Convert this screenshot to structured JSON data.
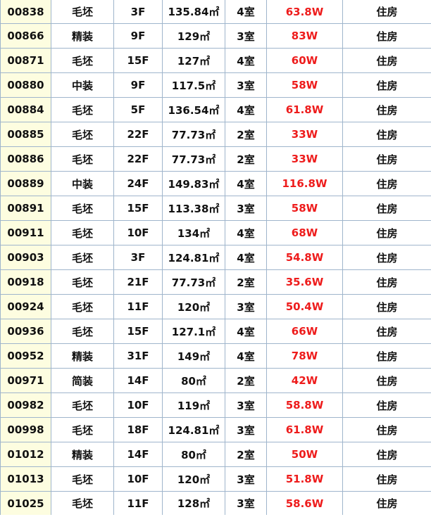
{
  "rows": [
    {
      "id": "00838",
      "decoration": "毛坯",
      "floor": "3F",
      "area": "135.84㎡",
      "rooms": "4室",
      "price": "63.8W",
      "type": "住房"
    },
    {
      "id": "00866",
      "decoration": "精装",
      "floor": "9F",
      "area": "129㎡",
      "rooms": "3室",
      "price": "83W",
      "type": "住房"
    },
    {
      "id": "00871",
      "decoration": "毛坯",
      "floor": "15F",
      "area": "127㎡",
      "rooms": "4室",
      "price": "60W",
      "type": "住房"
    },
    {
      "id": "00880",
      "decoration": "中装",
      "floor": "9F",
      "area": "117.5㎡",
      "rooms": "3室",
      "price": "58W",
      "type": "住房"
    },
    {
      "id": "00884",
      "decoration": "毛坯",
      "floor": "5F",
      "area": "136.54㎡",
      "rooms": "4室",
      "price": "61.8W",
      "type": "住房"
    },
    {
      "id": "00885",
      "decoration": "毛坯",
      "floor": "22F",
      "area": "77.73㎡",
      "rooms": "2室",
      "price": "33W",
      "type": "住房"
    },
    {
      "id": "00886",
      "decoration": "毛坯",
      "floor": "22F",
      "area": "77.73㎡",
      "rooms": "2室",
      "price": "33W",
      "type": "住房"
    },
    {
      "id": "00889",
      "decoration": "中装",
      "floor": "24F",
      "area": "149.83㎡",
      "rooms": "4室",
      "price": "116.8W",
      "type": "住房"
    },
    {
      "id": "00891",
      "decoration": "毛坯",
      "floor": "15F",
      "area": "113.38㎡",
      "rooms": "3室",
      "price": "58W",
      "type": "住房"
    },
    {
      "id": "00911",
      "decoration": "毛坯",
      "floor": "10F",
      "area": "134㎡",
      "rooms": "4室",
      "price": "68W",
      "type": "住房"
    },
    {
      "id": "00903",
      "decoration": "毛坯",
      "floor": "3F",
      "area": "124.81㎡",
      "rooms": "4室",
      "price": "54.8W",
      "type": "住房"
    },
    {
      "id": "00918",
      "decoration": "毛坯",
      "floor": "21F",
      "area": "77.73㎡",
      "rooms": "2室",
      "price": "35.6W",
      "type": "住房"
    },
    {
      "id": "00924",
      "decoration": "毛坯",
      "floor": "11F",
      "area": "120㎡",
      "rooms": "3室",
      "price": "50.4W",
      "type": "住房"
    },
    {
      "id": "00936",
      "decoration": "毛坯",
      "floor": "15F",
      "area": "127.1㎡",
      "rooms": "4室",
      "price": "66W",
      "type": "住房"
    },
    {
      "id": "00952",
      "decoration": "精装",
      "floor": "31F",
      "area": "149㎡",
      "rooms": "4室",
      "price": "78W",
      "type": "住房"
    },
    {
      "id": "00971",
      "decoration": "简装",
      "floor": "14F",
      "area": "80㎡",
      "rooms": "2室",
      "price": "42W",
      "type": "住房"
    },
    {
      "id": "00982",
      "decoration": "毛坯",
      "floor": "10F",
      "area": "119㎡",
      "rooms": "3室",
      "price": "58.8W",
      "type": "住房"
    },
    {
      "id": "00998",
      "decoration": "毛坯",
      "floor": "18F",
      "area": "124.81㎡",
      "rooms": "3室",
      "price": "61.8W",
      "type": "住房"
    },
    {
      "id": "01012",
      "decoration": "精装",
      "floor": "14F",
      "area": "80㎡",
      "rooms": "2室",
      "price": "50W",
      "type": "住房"
    },
    {
      "id": "01013",
      "decoration": "毛坯",
      "floor": "10F",
      "area": "120㎡",
      "rooms": "3室",
      "price": "51.8W",
      "type": "住房"
    },
    {
      "id": "01025",
      "decoration": "毛坯",
      "floor": "11F",
      "area": "128㎡",
      "rooms": "3室",
      "price": "58.6W",
      "type": "住房"
    }
  ],
  "colors": {
    "price_text": "#ee1c1c",
    "id_column_background": "#fdfde0",
    "grid_line": "#9fb5cc"
  }
}
